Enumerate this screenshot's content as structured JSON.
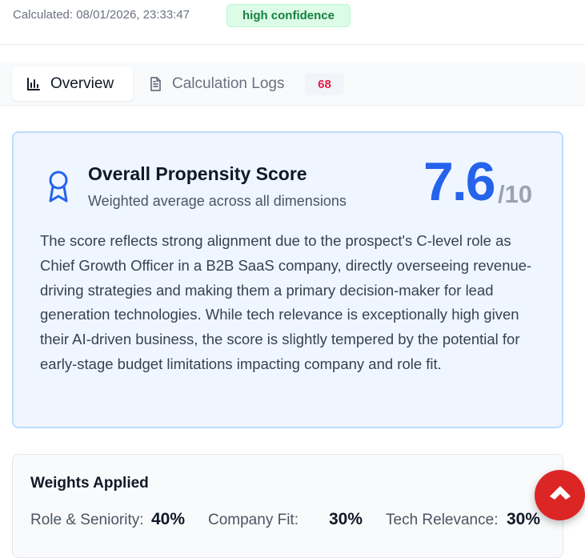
{
  "header": {
    "calculated_text": "Calculated: 08/01/2026, 23:33:47",
    "confidence_badge": "high confidence"
  },
  "tabs": [
    {
      "label": "Overview",
      "icon": "bar-chart-icon",
      "active": true
    },
    {
      "label": "Calculation Logs",
      "icon": "file-text-icon",
      "badge": "68"
    }
  ],
  "score_card": {
    "title": "Overall Propensity Score",
    "subtitle": "Weighted average across all dimensions",
    "score": "7.6",
    "max": "/10",
    "icon": "award-icon",
    "description": "The score reflects strong alignment due to the prospect's C-level role as Chief Growth Officer in a B2B SaaS company, directly overseeing revenue-driving strategies and making them a primary decision-maker for lead generation technologies. While tech relevance is exceptionally high given their AI-driven business, the score is slightly tempered by the potential for early-stage budget limitations impacting company and role fit."
  },
  "weights": {
    "title": "Weights Applied",
    "items": [
      {
        "label": "Role & Seniority:",
        "value": "40%"
      },
      {
        "label": "Company Fit:",
        "value": "30%"
      },
      {
        "label": "Tech Relevance:",
        "value": "30%"
      }
    ]
  },
  "fab": {
    "icon": "arrow-up-icon"
  },
  "colors": {
    "accent": "#2563eb",
    "card_bg": "#eff6ff",
    "badge_green": "#15803d",
    "badge_red": "#e11d48",
    "fab_red": "#dc2626"
  }
}
